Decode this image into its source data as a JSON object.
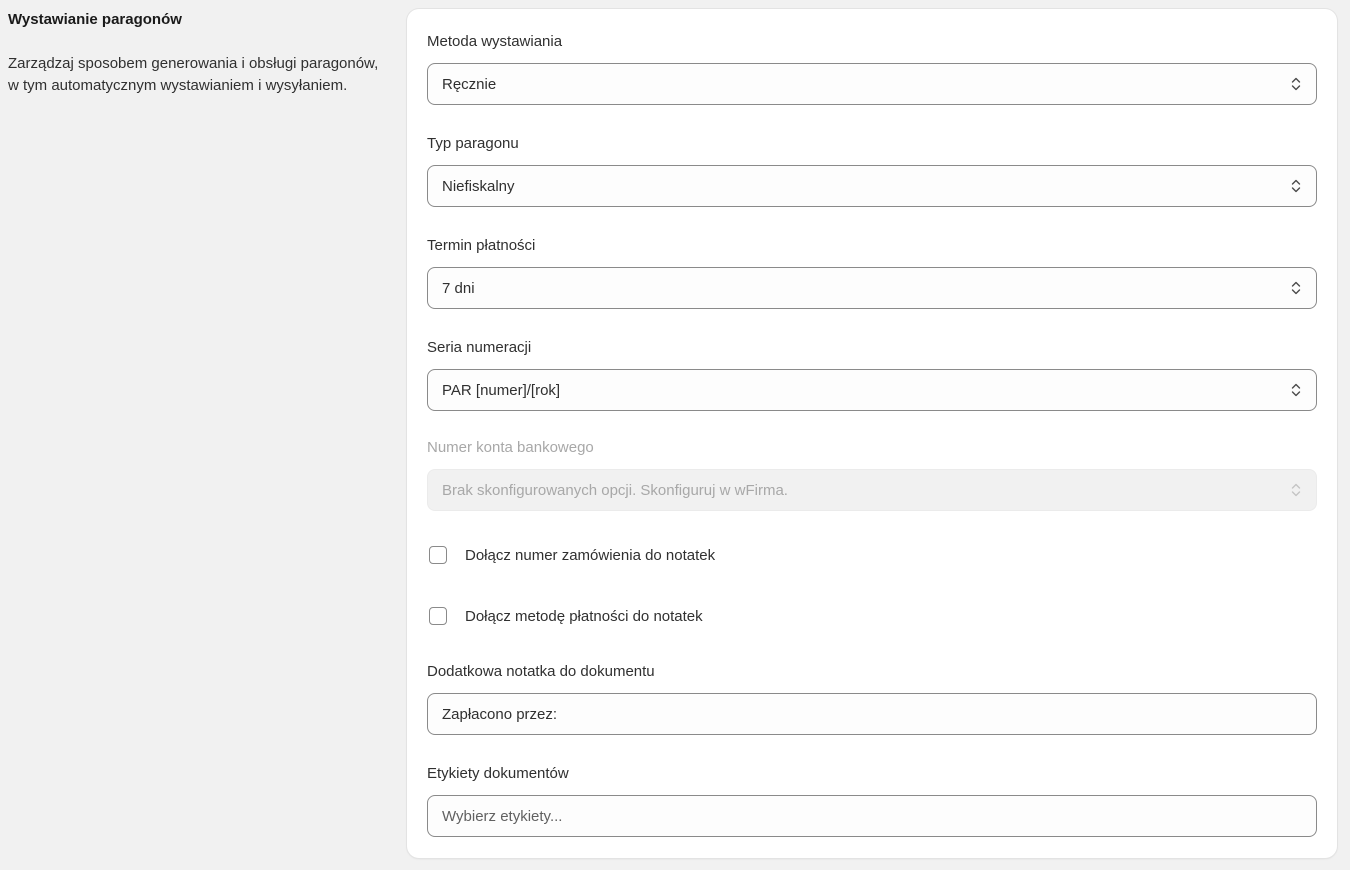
{
  "section": {
    "title": "Wystawianie paragonów",
    "description": "Zarządzaj sposobem generowania i obsługi paragonów, w tym automatycznym wystawianiem i wysyłaniem."
  },
  "fields": {
    "issue_method": {
      "label": "Metoda wystawiania",
      "value": "Ręcznie"
    },
    "receipt_type": {
      "label": "Typ paragonu",
      "value": "Niefiskalny"
    },
    "payment_term": {
      "label": "Termin płatności",
      "value": "7 dni"
    },
    "numbering_series": {
      "label": "Seria numeracji",
      "value": "PAR [numer]/[rok]"
    },
    "bank_account": {
      "label": "Numer konta bankowego",
      "value": "Brak skonfigurowanych opcji. Skonfiguruj w wFirma.",
      "disabled": true
    },
    "additional_note": {
      "label": "Dodatkowa notatka do dokumentu",
      "value": "Zapłacono przez:"
    },
    "document_labels": {
      "label": "Etykiety dokumentów",
      "placeholder": "Wybierz etykiety..."
    }
  },
  "checkboxes": {
    "include_order_number": {
      "label": "Dołącz numer zamówienia do notatek",
      "checked": false
    },
    "include_payment_method": {
      "label": "Dołącz metodę płatności do notatek",
      "checked": false
    }
  },
  "icons": {
    "select_arrows": "chevron-up-down-icon"
  },
  "colors": {
    "page_background": "#f1f1f1",
    "card_background": "#ffffff",
    "input_border": "#8a8a8a",
    "disabled_text": "#a8a8a8"
  }
}
